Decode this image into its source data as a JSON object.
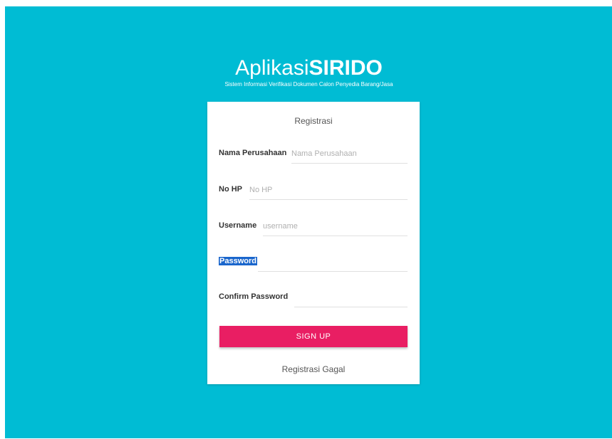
{
  "brand": {
    "name_regular": "Aplikasi",
    "name_bold": "SIRIDO",
    "subtitle": "Sistem Informasi Verifikasi Dokumen Calon Penyedia Barang/Jasa"
  },
  "form": {
    "title": "Registrasi",
    "fields": [
      {
        "label": "Nama Perusahaan",
        "placeholder": "Nama Perusahaan",
        "value": ""
      },
      {
        "label": "No HP",
        "placeholder": "No HP",
        "value": ""
      },
      {
        "label": "Username",
        "placeholder": "username",
        "value": ""
      },
      {
        "label": "Password",
        "placeholder": "",
        "value": ""
      },
      {
        "label": "Confirm Password",
        "placeholder": "",
        "value": ""
      }
    ],
    "submit_label": "SIGN UP",
    "status_message": "Registrasi Gagal"
  },
  "colors": {
    "background": "#00bcd4",
    "button": "#e91e63",
    "selection": "#1a66cc"
  }
}
